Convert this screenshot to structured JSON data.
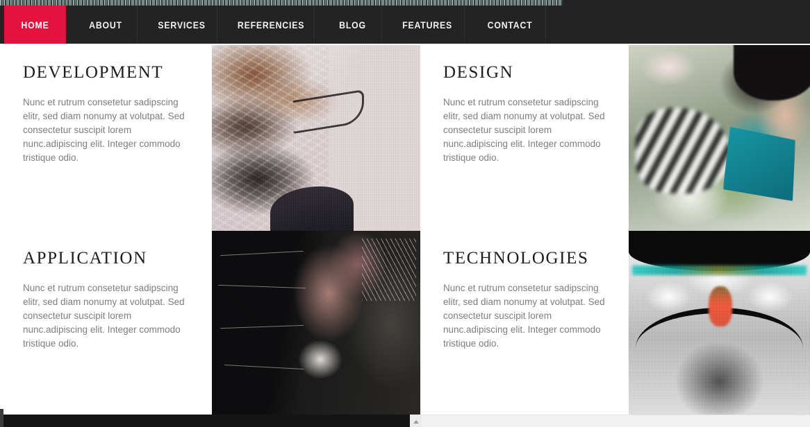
{
  "site": {
    "nav": {
      "items": [
        {
          "label": "HOME",
          "active": true
        },
        {
          "label": "ABOUT",
          "active": false
        },
        {
          "label": "SERVICES",
          "active": false
        },
        {
          "label": "REFERENCIES",
          "active": false
        },
        {
          "label": "BLOG",
          "active": false
        },
        {
          "label": "FEATURES",
          "active": false
        },
        {
          "label": "CONTACT",
          "active": false
        }
      ],
      "active_color": "#e4123c",
      "bar_color": "#232323",
      "text_color": "#f2f2f2"
    },
    "body_text": "Nunc et rutrum consetetur sadipscing elitr, sed diam nonumy at volutpat. Sed consectetur suscipit lorem nunc.adipiscing elit. Integer commodo tristique odio.",
    "cells": [
      {
        "title": "DEVELOPMENT",
        "body": "Nunc et rutrum consetetur sadipscing elitr, sed diam nonumy at volutpat. Sed consectetur suscipit lorem nunc.adipiscing elit. Integer commodo tristique odio.",
        "image_alt": "abstract-paper-banknote-face-with-glasses"
      },
      {
        "title": "DESIGN",
        "body": "Nunc et rutrum consetetur sadipscing elitr, sed diam nonumy at volutpat. Sed consectetur suscipit lorem nunc.adipiscing elit. Integer commodo tristique odio.",
        "image_alt": "boy-in-teal-shirt-among-blossoms"
      },
      {
        "title": "APPLICATION",
        "body": "Nunc et rutrum consetetur sadipscing elitr, sed diam nonumy at volutpat. Sed consectetur suscipit lorem nunc.adipiscing elit. Integer commodo tristique odio.",
        "image_alt": "dark-sketched-portrait"
      },
      {
        "title": "TECHNOLOGIES",
        "body": "Nunc et rutrum consetetur sadipscing elitr, sed diam nonumy at volutpat. Sed consectetur suscipit lorem nunc.adipiscing elit. Integer commodo tristique odio.",
        "image_alt": "high-contrast-face-with-sunglasses"
      }
    ],
    "colors": {
      "heading": "#1d1d1d",
      "body": "#7d7d7d",
      "page_bg": "#ffffff",
      "footer": "#141414"
    },
    "scrollbar": {
      "arrow_glyph": "up-arrow"
    }
  }
}
